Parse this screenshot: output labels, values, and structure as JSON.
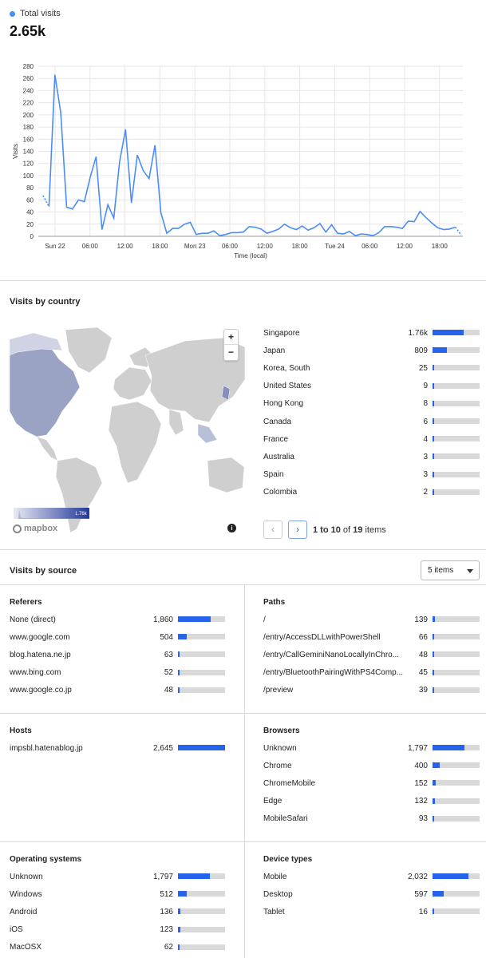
{
  "summary": {
    "legend_label": "Total visits",
    "total": "2.65k",
    "accent": "#4a8df8"
  },
  "chart_data": {
    "type": "line",
    "ylabel": "Visits",
    "xlabel": "Time (local)",
    "ylim": [
      0,
      280
    ],
    "yticks": [
      0,
      20,
      40,
      60,
      80,
      100,
      120,
      140,
      160,
      180,
      200,
      220,
      240,
      260,
      280
    ],
    "xtick_labels": [
      "Sun 22",
      "06:00",
      "12:00",
      "18:00",
      "Mon 23",
      "06:00",
      "12:00",
      "18:00",
      "Tue 24",
      "06:00",
      "12:00",
      "18:00"
    ],
    "grid": true,
    "series": [
      {
        "values": [
          67,
          49,
          266,
          204,
          48,
          45,
          60,
          57,
          97,
          131,
          11,
          52,
          30,
          123,
          176,
          55,
          134,
          108,
          95,
          150,
          39,
          5,
          13,
          13,
          20,
          23,
          3,
          5,
          5,
          9,
          1,
          3,
          6,
          6,
          7,
          16,
          15,
          12,
          5,
          8,
          12,
          20,
          14,
          11,
          17,
          10,
          14,
          21,
          7,
          19,
          5,
          4,
          8,
          1,
          4,
          3,
          1,
          6,
          16,
          16,
          15,
          13,
          25,
          24,
          41,
          31,
          22,
          14,
          11,
          12,
          15,
          2
        ]
      }
    ]
  },
  "country": {
    "title": "Visits by country",
    "map_scale_max": "1.76k",
    "map_logo": "mapbox",
    "zoom_in": "+",
    "zoom_out": "−",
    "items": [
      {
        "label": "Singapore",
        "value": "1.76k",
        "share": 0.66
      },
      {
        "label": "Japan",
        "value": "809",
        "share": 0.31
      },
      {
        "label": "Korea, South",
        "value": "25",
        "share": 0.012
      },
      {
        "label": "United States",
        "value": "9",
        "share": 0.005
      },
      {
        "label": "Hong Kong",
        "value": "8",
        "share": 0.005
      },
      {
        "label": "Canada",
        "value": "6",
        "share": 0.004
      },
      {
        "label": "France",
        "value": "4",
        "share": 0.003
      },
      {
        "label": "Australia",
        "value": "3",
        "share": 0.003
      },
      {
        "label": "Spain",
        "value": "3",
        "share": 0.003
      },
      {
        "label": "Colombia",
        "value": "2",
        "share": 0.002
      }
    ],
    "pager": {
      "range": "1 to 10",
      "of": "of",
      "total": "19",
      "suffix": "items",
      "prev": "‹",
      "next": "›"
    }
  },
  "source": {
    "title": "Visits by source",
    "select_value": "5 items",
    "panels": [
      {
        "title": "Referers",
        "items": [
          {
            "label": "None (direct)",
            "value": "1,860",
            "share": 0.7
          },
          {
            "label": "www.google.com",
            "value": "504",
            "share": 0.19
          },
          {
            "label": "blog.hatena.ne.jp",
            "value": "63",
            "share": 0.03
          },
          {
            "label": "www.bing.com",
            "value": "52",
            "share": 0.02
          },
          {
            "label": "www.google.co.jp",
            "value": "48",
            "share": 0.02
          }
        ]
      },
      {
        "title": "Paths",
        "items": [
          {
            "label": "/",
            "value": "139",
            "share": 0.05
          },
          {
            "label": "/entry/AccessDLLwithPowerShell",
            "value": "66",
            "share": 0.03
          },
          {
            "label": "/entry/CallGeminiNanoLocallyInChro...",
            "value": "48",
            "share": 0.02
          },
          {
            "label": "/entry/BluetoothPairingWithPS4Comp...",
            "value": "45",
            "share": 0.02
          },
          {
            "label": "/preview",
            "value": "39",
            "share": 0.02
          }
        ]
      },
      {
        "title": "Hosts",
        "items": [
          {
            "label": "impsbl.hatenablog.jp",
            "value": "2,645",
            "share": 1.0
          }
        ]
      },
      {
        "title": "Browsers",
        "items": [
          {
            "label": "Unknown",
            "value": "1,797",
            "share": 0.68
          },
          {
            "label": "Chrome",
            "value": "400",
            "share": 0.15
          },
          {
            "label": "ChromeMobile",
            "value": "152",
            "share": 0.06
          },
          {
            "label": "Edge",
            "value": "132",
            "share": 0.05
          },
          {
            "label": "MobileSafari",
            "value": "93",
            "share": 0.04
          }
        ]
      },
      {
        "title": "Operating systems",
        "items": [
          {
            "label": "Unknown",
            "value": "1,797",
            "share": 0.68
          },
          {
            "label": "Windows",
            "value": "512",
            "share": 0.19
          },
          {
            "label": "Android",
            "value": "136",
            "share": 0.05
          },
          {
            "label": "iOS",
            "value": "123",
            "share": 0.05
          },
          {
            "label": "MacOSX",
            "value": "62",
            "share": 0.02
          }
        ]
      },
      {
        "title": "Device types",
        "items": [
          {
            "label": "Mobile",
            "value": "2,032",
            "share": 0.77
          },
          {
            "label": "Desktop",
            "value": "597",
            "share": 0.23
          },
          {
            "label": "Tablet",
            "value": "16",
            "share": 0.01
          }
        ]
      }
    ]
  }
}
